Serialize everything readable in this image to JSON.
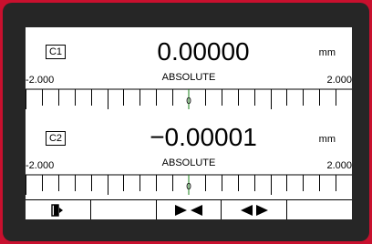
{
  "channels": [
    {
      "label": "C1",
      "value": "0.00000",
      "unit": "mm",
      "mode": "ABSOLUTE",
      "scale_min": "-2.000",
      "scale_max": "2.000",
      "pointer": "0"
    },
    {
      "label": "C2",
      "value": "−0.00001",
      "unit": "mm",
      "mode": "ABSOLUTE",
      "scale_min": "-2.000",
      "scale_max": "2.000",
      "pointer": "0"
    }
  ],
  "softkeys": [
    {
      "name": "exit-icon"
    },
    {
      "name": "empty"
    },
    {
      "name": "arrows-inward-icon"
    },
    {
      "name": "arrows-outward-icon"
    },
    {
      "name": "empty"
    }
  ],
  "colors": {
    "bezel_red": "#c8102e",
    "pointer": "#1a7f1a"
  }
}
